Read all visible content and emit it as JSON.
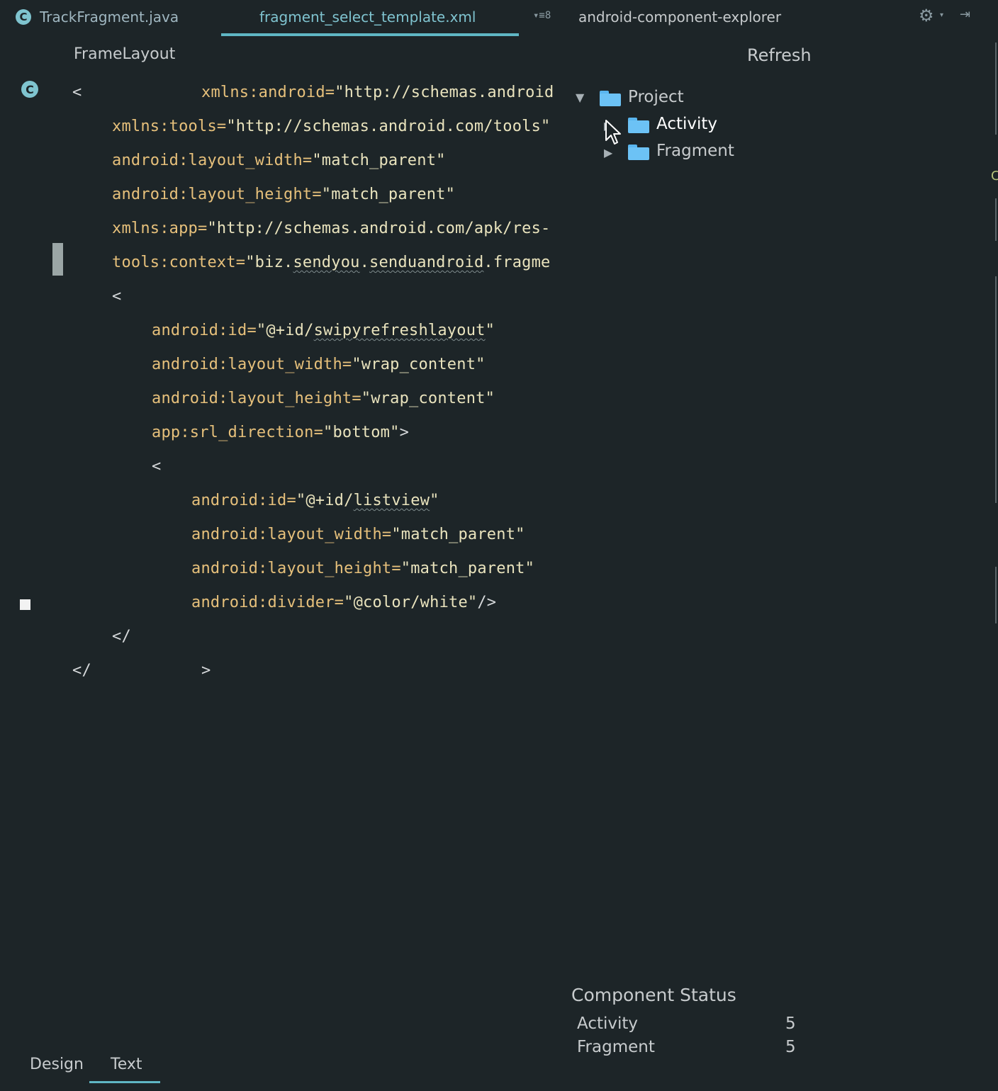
{
  "tabs": {
    "file1": {
      "label": "TrackFragment.java",
      "icon": "class-c-icon"
    },
    "file2": {
      "label": "fragment_select_template.xml"
    },
    "overflow_count": "8",
    "panel": {
      "label": "android-component-explorer"
    }
  },
  "editor": {
    "breadcrumb": "FrameLayout",
    "lines": [
      {
        "attr": "xmlns:android=",
        "val": "\"http://schemas.android"
      },
      {
        "attr": "xmlns:tools=",
        "val": "\"http://schemas.android.com/tools\""
      },
      {
        "attr": "android:layout_width=",
        "val": "\"match_parent\""
      },
      {
        "attr": "android:layout_height=",
        "val": "\"match_parent\""
      },
      {
        "attr": "xmlns:app=",
        "val": "\"http://schemas.android.com/apk/res-"
      },
      {
        "attr": "tools:context=",
        "val_a": "\"biz.",
        "val_b": "sendyou",
        "val_c": ".",
        "val_d": "senduandroid",
        "val_e": ".fragme"
      },
      {
        "attr": "android:id=",
        "val_a": "\"@+id/",
        "val_b": "swipyrefreshlayout",
        "val_c": "\""
      },
      {
        "attr": "android:layout_width=",
        "val": "\"wrap_content\""
      },
      {
        "attr": "android:layout_height=",
        "val": "\"wrap_content\""
      },
      {
        "attr": "app:srl_direction=",
        "val": "\"bottom\"",
        "tail": ">"
      },
      {
        "attr": "android:id=",
        "val_a": "\"@+id/",
        "val_b": "listview",
        "val_c": "\""
      },
      {
        "attr": "android:layout_width=",
        "val": "\"match_parent\""
      },
      {
        "attr": "android:layout_height=",
        "val": "\"match_parent\""
      },
      {
        "attr": "android:divider=",
        "val": "\"@color/white\"",
        "tail": "/>"
      }
    ],
    "open_bracket": "<",
    "close_open": "</",
    "close_gt": ">"
  },
  "explorer": {
    "refresh_label": "Refresh",
    "tree": {
      "root": "Project",
      "children": [
        "Activity",
        "Fragment"
      ]
    }
  },
  "status": {
    "title": "Component Status",
    "rows": [
      {
        "name": "Activity",
        "count": "5"
      },
      {
        "name": "Fragment",
        "count": "5"
      }
    ]
  },
  "bottom_tabs": {
    "design": "Design",
    "text": "Text"
  },
  "colors": {
    "background": "#1d2528",
    "accent": "#5fb6c4",
    "attribute": "#e6c07b",
    "folder": "#6cc2f5"
  }
}
